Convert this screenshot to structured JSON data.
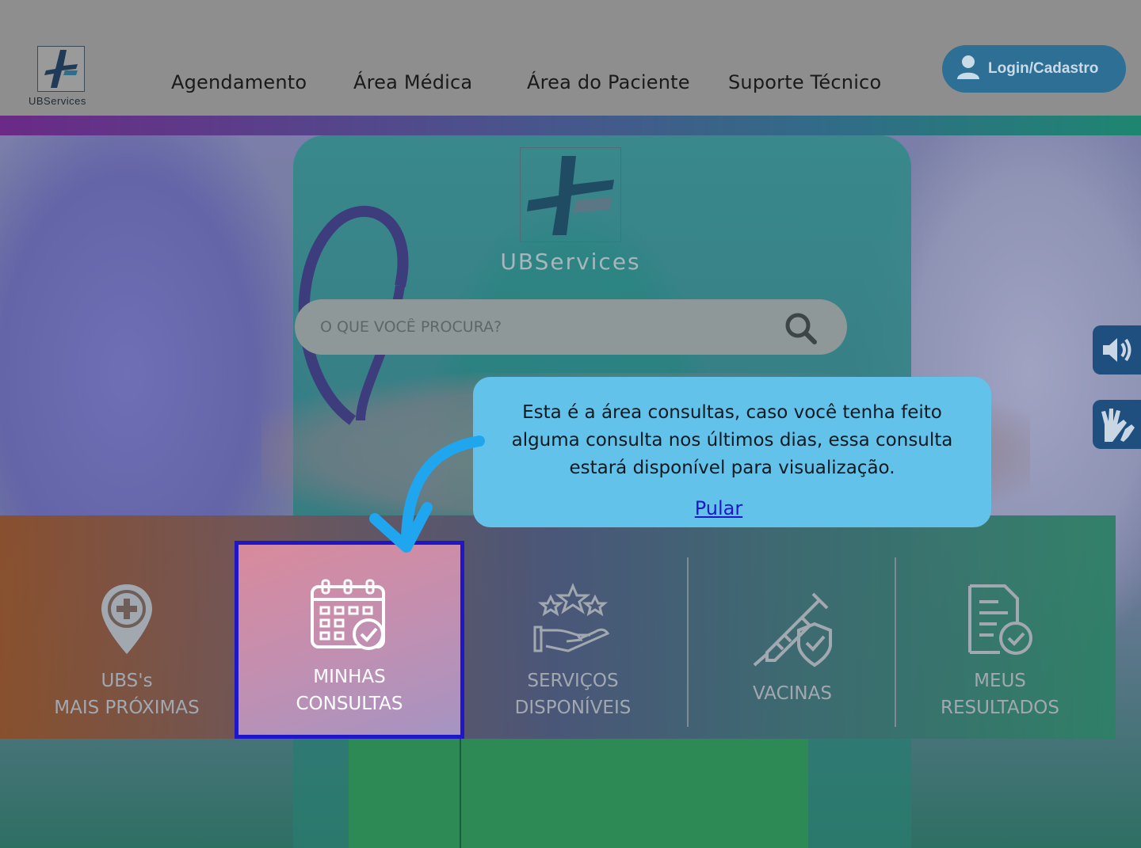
{
  "header": {
    "logo_text": "UBServices",
    "nav": [
      {
        "label": "Agendamento"
      },
      {
        "label": "Área Médica"
      },
      {
        "label": "Área do Paciente"
      },
      {
        "label": "Suporte Técnico"
      }
    ],
    "login_label": "Login/Cadastro"
  },
  "hero": {
    "logo_text": "UBServices",
    "search_placeholder": "O QUE VOCÊ PROCURA?"
  },
  "tooltip": {
    "text": "Esta é a área consultas, caso você tenha feito alguma consulta nos últimos dias, essa consulta estará disponível para visualização.",
    "skip_label": " Pular "
  },
  "menu": {
    "items": [
      {
        "line1": "UBS's",
        "line2": "MAIS PRÓXIMAS"
      },
      {
        "line1": "MINHAS",
        "line2": "CONSULTAS"
      },
      {
        "line1": "SERVIÇOS",
        "line2": "DISPONÍVEIS"
      },
      {
        "line1": "VACINAS",
        "line2": ""
      },
      {
        "line1": "MEUS",
        "line2": "RESULTADOS"
      }
    ]
  },
  "colors": {
    "login_button": "#2d6f95",
    "tooltip_bg": "#63c2ea",
    "highlight_border": "#1f16c8",
    "accessibility_buttons": "#1f4f7f"
  }
}
